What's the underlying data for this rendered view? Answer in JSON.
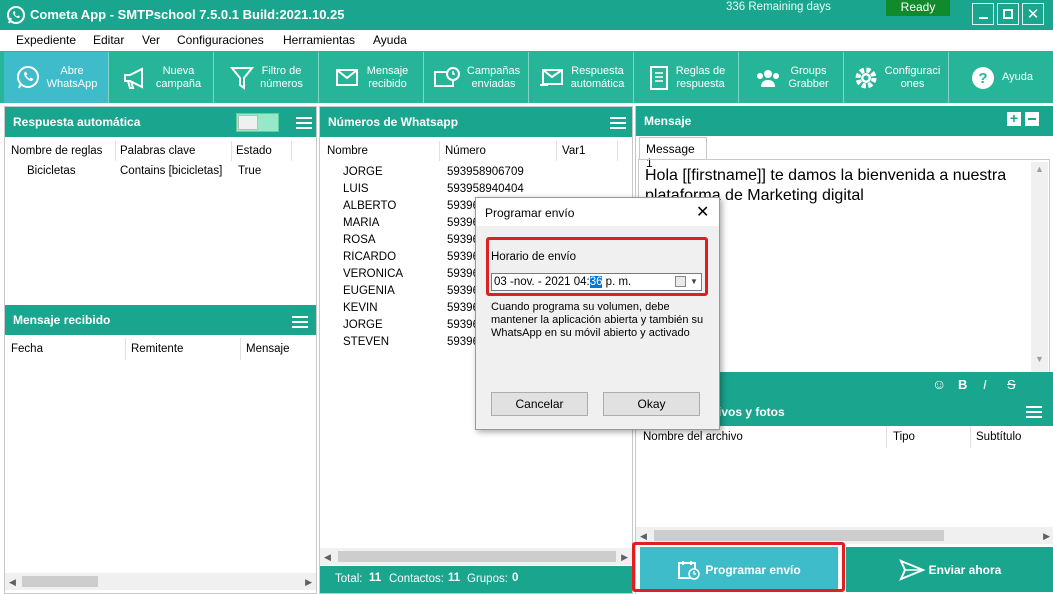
{
  "window": {
    "title": "Cometa App - SMTPschool 7.5.0.1 Build:2021.10.25",
    "remaining": "336 Remaining days",
    "status": "Ready"
  },
  "menu": [
    "Expediente",
    "Editar",
    "Ver",
    "Configuraciones",
    "Herramientas",
    "Ayuda"
  ],
  "toolbar": [
    {
      "l1": "Abre",
      "l2": "WhatsApp",
      "icon": "whatsapp-icon"
    },
    {
      "l1": "Nueva",
      "l2": "campaña",
      "icon": "megaphone-icon"
    },
    {
      "l1": "Filtro de",
      "l2": "números",
      "icon": "filter-icon"
    },
    {
      "l1": "Mensaje",
      "l2": "recibido",
      "icon": "mail-in-icon"
    },
    {
      "l1": "Campañas",
      "l2": "enviadas",
      "icon": "mail-clock-icon"
    },
    {
      "l1": "Respuesta",
      "l2": "automática",
      "icon": "mail-reply-icon"
    },
    {
      "l1": "Reglas de",
      "l2": "respuesta",
      "icon": "rules-icon"
    },
    {
      "l1": "Groups",
      "l2": "Grabber",
      "icon": "users-icon"
    },
    {
      "l1": "Configuraci",
      "l2": "ones",
      "icon": "gear-icon"
    },
    {
      "l1": "Ayuda",
      "l2": "",
      "icon": "help-icon"
    }
  ],
  "auto_reply": {
    "title": "Respuesta automática",
    "columns": [
      "Nombre de reglas",
      "Palabras clave",
      "Estado"
    ],
    "rows": [
      {
        "name": "Bicicletas",
        "keywords": "Contains [bicicletas]",
        "state": "True"
      }
    ]
  },
  "received": {
    "title": "Mensaje recibido",
    "columns": [
      "Fecha",
      "Remitente",
      "Mensaje"
    ]
  },
  "numbers": {
    "title": "Números de Whatsapp",
    "columns": [
      "Nombre",
      "Número",
      "Var1"
    ],
    "rows": [
      {
        "name": "JORGE",
        "number": "593958906709"
      },
      {
        "name": "LUIS",
        "number": "593958940404"
      },
      {
        "name": "ALBERTO",
        "number": "59396"
      },
      {
        "name": "MARIA",
        "number": "59396"
      },
      {
        "name": "ROSA",
        "number": "59396"
      },
      {
        "name": "RICARDO",
        "number": "59396"
      },
      {
        "name": "VERONICA",
        "number": "59396"
      },
      {
        "name": "EUGENIA",
        "number": "59396"
      },
      {
        "name": "KEVIN",
        "number": "59396"
      },
      {
        "name": "JORGE",
        "number": "59396"
      },
      {
        "name": "STEVEN",
        "number": "59396"
      }
    ],
    "footer": {
      "total_label": "Total:",
      "total": "11",
      "contacts_label": "Contactos:",
      "contacts": "11",
      "groups_label": "Grupos:",
      "groups": "0"
    }
  },
  "message": {
    "title": "Mensaje",
    "tab": "Message 1",
    "text": "Hola [[firstname]] te damos la bienvenida a nuestra plataforma de Marketing digital"
  },
  "files": {
    "title": "ivos y fotos",
    "columns": [
      "Nombre del archivo",
      "Tipo",
      "Subtítulo"
    ]
  },
  "actions": {
    "schedule": "Programar envío",
    "send_now": "Enviar ahora"
  },
  "dialog": {
    "title": "Programar envío",
    "label": "Horario de envío",
    "date_prefix": "03 -nov. - 2021  04:",
    "minute": "36",
    "ampm": " p. m.",
    "note": "Cuando programa su volumen, debe mantener la aplicación abierta y también su WhatsApp en su móvil abierto y activado",
    "cancel": "Cancelar",
    "ok": "Okay"
  }
}
